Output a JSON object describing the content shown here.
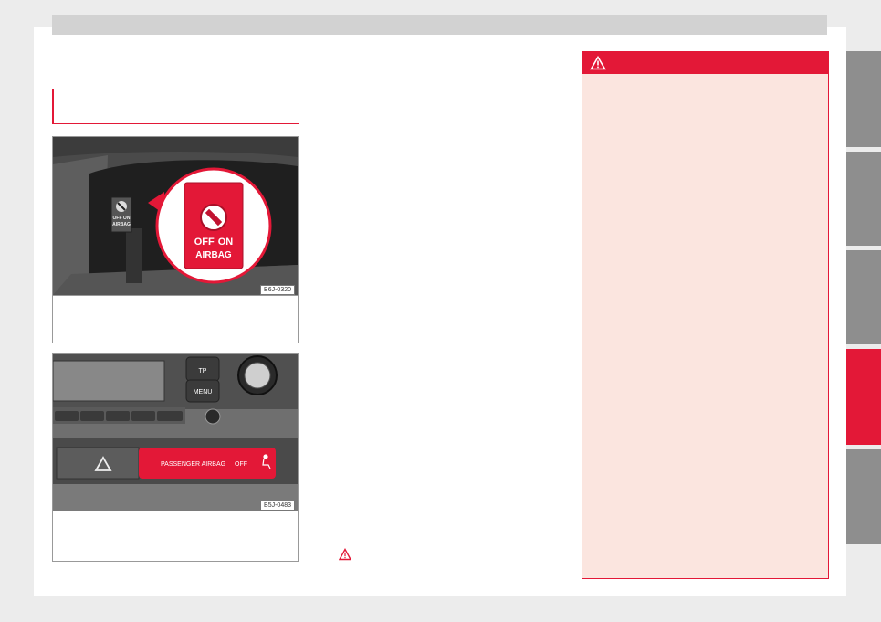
{
  "figures": [
    {
      "code": "B6J-0320",
      "callout": {
        "off": "OFF",
        "on": "ON",
        "airbag": "AIRBAG"
      }
    },
    {
      "code": "B5J-0483",
      "buttons": {
        "tp": "TP",
        "menu": "MENU"
      },
      "airbag_label": "PASSENGER AIRBAG",
      "airbag_status": "OFF"
    }
  ],
  "icons": {
    "warning": "warning-triangle-icon",
    "hazard": "hazard-triangle-icon",
    "key": "key-icon",
    "seat_person": "seated-passenger-icon"
  },
  "colors": {
    "accent": "#e31837",
    "warning_bg": "#fbe5df",
    "tab": "#8e8e8e"
  },
  "side_tabs": {
    "count": 5,
    "active_index": 3
  }
}
